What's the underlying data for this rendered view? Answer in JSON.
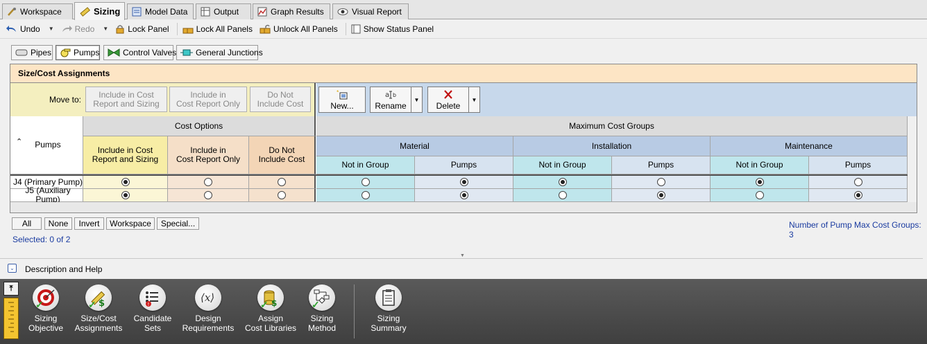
{
  "tabs": [
    {
      "label": "Workspace",
      "icon": "workspace-icon"
    },
    {
      "label": "Sizing",
      "icon": "sizing-icon"
    },
    {
      "label": "Model Data",
      "icon": "model-data-icon"
    },
    {
      "label": "Output",
      "icon": "output-icon"
    },
    {
      "label": "Graph Results",
      "icon": "graph-results-icon"
    },
    {
      "label": "Visual Report",
      "icon": "visual-report-icon"
    }
  ],
  "toolbar": {
    "undo": "Undo",
    "redo": "Redo",
    "lock_panel": "Lock Panel",
    "lock_all": "Lock All Panels",
    "unlock_all": "Unlock All Panels",
    "show_status": "Show Status Panel"
  },
  "types": {
    "pipes": "Pipes",
    "pumps": "Pumps",
    "control_valves": "Control Valves",
    "general_junctions": "General Junctions"
  },
  "panel": {
    "title": "Size/Cost Assignments",
    "move_to": "Move to:",
    "move_buttons": [
      {
        "line1": "Include in Cost",
        "line2": "Report and Sizing"
      },
      {
        "line1": "Include in",
        "line2": "Cost Report Only"
      },
      {
        "line1": "Do Not",
        "line2": "Include Cost"
      }
    ],
    "actions": {
      "new": "New...",
      "rename": "Rename",
      "delete": "Delete"
    }
  },
  "grid": {
    "pumps_header": "Pumps",
    "cost_options": "Cost Options",
    "max_cost_groups": "Maximum Cost Groups",
    "opt_headers": [
      {
        "line1": "Include in Cost",
        "line2": "Report and Sizing"
      },
      {
        "line1": "Include in",
        "line2": "Cost Report Only"
      },
      {
        "line1": "Do Not",
        "line2": "Include Cost"
      }
    ],
    "groups": [
      "Material",
      "Installation",
      "Maintenance"
    ],
    "sub_headers": [
      "Not in Group",
      "Pumps"
    ],
    "rows": [
      {
        "name": "J4 (Primary Pump)",
        "option": 0,
        "groups": [
          1,
          0,
          0
        ]
      },
      {
        "name": "J5 (Auxiliary Pump)",
        "option": 0,
        "groups": [
          1,
          1,
          1
        ]
      }
    ]
  },
  "filter": {
    "all": "All",
    "none": "None",
    "invert": "Invert",
    "workspace": "Workspace",
    "special": "Special..."
  },
  "selected": "Selected: 0 of 2",
  "group_count": "Number of Pump Max Cost Groups: 3",
  "description": "Description and Help",
  "nav": [
    {
      "line1": "Sizing",
      "line2": "Objective",
      "icon": "target-icon"
    },
    {
      "line1": "Size/Cost",
      "line2": "Assignments",
      "icon": "ruler-dollar-icon"
    },
    {
      "line1": "Candidate",
      "line2": "Sets",
      "icon": "candidate-sets-icon"
    },
    {
      "line1": "Design",
      "line2": "Requirements",
      "icon": "function-x-icon"
    },
    {
      "line1": "Assign",
      "line2": "Cost Libraries",
      "icon": "cost-library-icon"
    },
    {
      "line1": "Sizing",
      "line2": "Method",
      "icon": "flowchart-icon"
    },
    {
      "line1": "Sizing",
      "line2": "Summary",
      "icon": "clipboard-icon"
    }
  ],
  "colors": {
    "title_bg": "#fde5c5",
    "moveto_bg": "#f4efbf",
    "actions_bg": "#c7d8eb",
    "opt1": "#fbf6d6",
    "opt2": "#f6e5d5",
    "opt3": "#f5e1cd",
    "blue_hdr": "#b8cbe4",
    "cyan": "#bfe6ec",
    "light": "#e0e8f2"
  }
}
